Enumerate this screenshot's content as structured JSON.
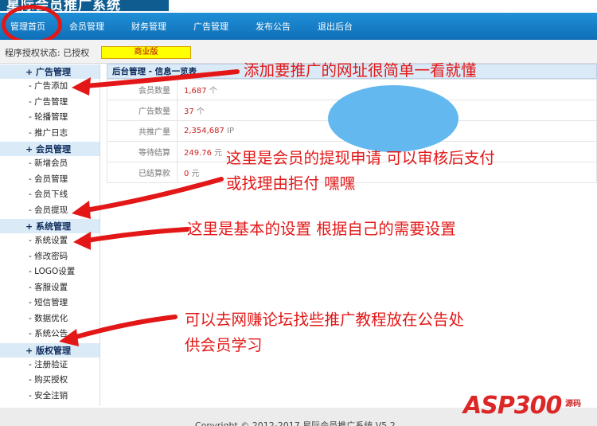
{
  "app": {
    "title": "星际会员推广系统"
  },
  "nav": {
    "items": [
      "管理首页",
      "会员管理",
      "财务管理",
      "广告管理",
      "发布公告",
      "退出后台"
    ]
  },
  "status": {
    "label": "程序授权状态: 已授权",
    "license": "商业版"
  },
  "sidebar": {
    "sections": [
      {
        "title": "+ 广告管理",
        "items": [
          "- 广告添加",
          "- 广告管理",
          "- 轮播管理",
          "- 推广日志"
        ]
      },
      {
        "title": "+ 会员管理",
        "items": [
          "- 新增会员",
          "- 会员管理",
          "- 会员下线",
          "- 会员提现"
        ]
      },
      {
        "title": "+ 系统管理",
        "items": [
          "- 系统设置",
          "- 修改密码",
          "- LOGO设置",
          "- 客服设置",
          "- 短信管理",
          "- 数据优化",
          "- 系统公告"
        ]
      },
      {
        "title": "+ 版权管理",
        "items": [
          "- 注册验证",
          "- 购买授权",
          "- 安全注销"
        ]
      }
    ]
  },
  "content": {
    "title": "后台管理 - 信息一览表",
    "rows": [
      {
        "label": "会员数量",
        "value": "1,687",
        "unit": " 个"
      },
      {
        "label": "广告数量",
        "value": "37",
        "unit": " 个"
      },
      {
        "label": "共推广量",
        "value": "2,354,687",
        "unit": " IP"
      },
      {
        "label": "等待结算",
        "value": "249.76",
        "unit": " 元"
      },
      {
        "label": "已结算款",
        "value": "0",
        "unit": " 元"
      }
    ]
  },
  "annotations": {
    "a1": "添加要推广的网址很简单一看就懂",
    "a2_line1": "这里是会员的提现申请 可以审核后支付",
    "a2_line2": "或找理由拒付 嘿嘿",
    "a3": "这里是基本的设置 根据自己的需要设置",
    "a4_line1": "可以去网赚论坛找些推广教程放在公告处",
    "a4_line2": "供会员学习"
  },
  "footer": {
    "copyright": "Copyright © 2012-2017 星际会员推广系统 V5.2"
  },
  "watermark": {
    "main": "ASP300",
    "side": "源码"
  },
  "colors": {
    "nav_bg": "#1a86d0",
    "annotation_red": "#e31717",
    "sidebar_header_bg": "#dbeaf7",
    "license_badge_bg": "#ffff00",
    "value_red": "#cc2222",
    "blob_blue": "#63b8ef"
  }
}
